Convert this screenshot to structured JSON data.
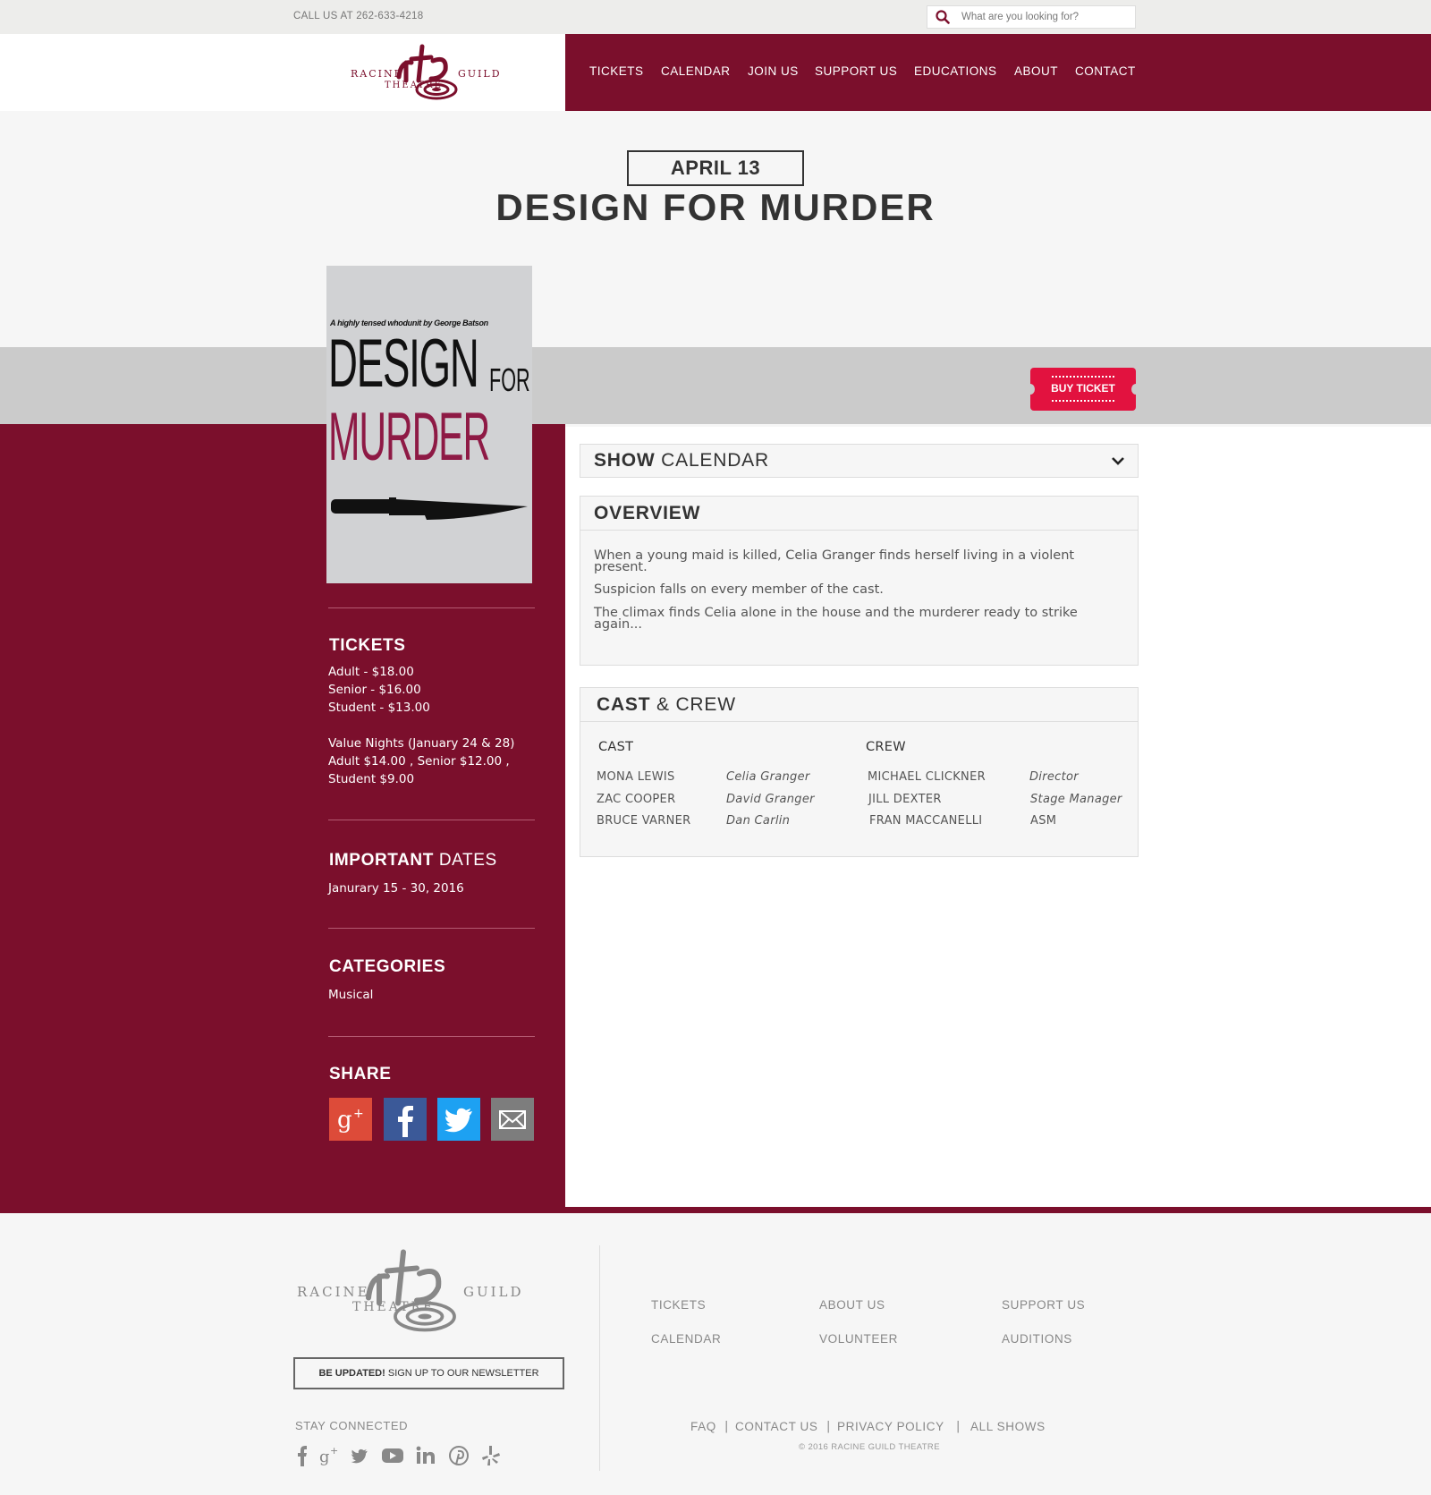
{
  "topbar": {
    "phone": "CALL US AT 262-633-4218",
    "search_placeholder": "What are you looking for?"
  },
  "logo": {
    "left": "RACINE",
    "right": "GUILD",
    "bottom": "THEATRE",
    "mark": "rtg"
  },
  "nav": [
    "TICKETS",
    "CALENDAR",
    "JOIN US",
    "SUPPORT US",
    "EDUCATIONS",
    "ABOUT",
    "CONTACT"
  ],
  "event": {
    "date": "APRIL 13",
    "title": "DESIGN FOR MURDER"
  },
  "poster": {
    "tagline": "A highly tensed whodunit by George Batson",
    "line1": "DESIGN",
    "line1b": "FOR",
    "line2": "MURDER"
  },
  "buy_ticket": "BUY TICKET",
  "show_calendar": {
    "bold": "SHOW",
    "rest": " CALENDAR"
  },
  "overview": {
    "heading": "OVERVIEW",
    "p1": "When a young maid is killed, Celia Granger finds herself living in a violent present.",
    "p2": "Suspicion falls on every member of the cast.",
    "p3": "The climax finds Celia alone in the house and the murderer ready to strike again..."
  },
  "cast_crew": {
    "heading_bold": "CAST",
    "heading_rest": " & CREW",
    "cast_label": "CAST",
    "crew_label": "CREW",
    "cast": [
      {
        "name": "MONA LEWIS",
        "role": "Celia Granger"
      },
      {
        "name": "ZAC COOPER",
        "role": "David Granger"
      },
      {
        "name": "BRUCE VARNER",
        "role": "Dan Carlin"
      }
    ],
    "crew": [
      {
        "name": "MICHAEL CLICKNER",
        "role": "Director"
      },
      {
        "name": "JILL DEXTER",
        "role": "Stage Manager"
      },
      {
        "name": "FRAN MACCANELLI",
        "role": "ASM"
      }
    ]
  },
  "sidebar": {
    "tickets_heading": "TICKETS",
    "tickets": [
      "Adult - $18.00",
      "Senior - $16.00",
      "Student - $13.00"
    ],
    "value_nights": [
      "Value Nights (January 24 & 28)",
      "Adult $14.00 , Senior $12.00 ,",
      "Student $9.00"
    ],
    "dates_heading_bold": "IMPORTANT",
    "dates_heading_rest": " DATES",
    "dates": "Janurary 15 - 30, 2016",
    "categories_heading": "CATEGORIES",
    "categories": "Musical",
    "share_heading": "SHARE"
  },
  "share_icons": [
    "google-plus-icon",
    "facebook-icon",
    "twitter-icon",
    "email-icon"
  ],
  "colors": {
    "brand": "#7b0f2c",
    "buy": "#e2123f",
    "gplus": "#dd4b39",
    "facebook": "#3b5998",
    "twitter": "#1da1f2",
    "email": "#7d7d7d"
  },
  "footer": {
    "newsletter_bold": "BE UPDATED!",
    "newsletter_rest": " SIGN UP TO OUR NEWSLETTER",
    "stay_connected": "STAY CONNECTED",
    "links": [
      "TICKETS",
      "ABOUT US",
      "SUPPORT US",
      "CALENDAR",
      "VOLUNTEER",
      "AUDITIONS"
    ],
    "bottom_links": [
      "FAQ",
      "CONTACT US",
      "PRIVACY POLICY",
      "ALL SHOWS"
    ],
    "copyright": "© 2016 RACINE GUILD THEATRE",
    "social": [
      "facebook-icon",
      "google-plus-icon",
      "twitter-icon",
      "youtube-icon",
      "linkedin-icon",
      "pinterest-icon",
      "yelp-icon"
    ]
  }
}
